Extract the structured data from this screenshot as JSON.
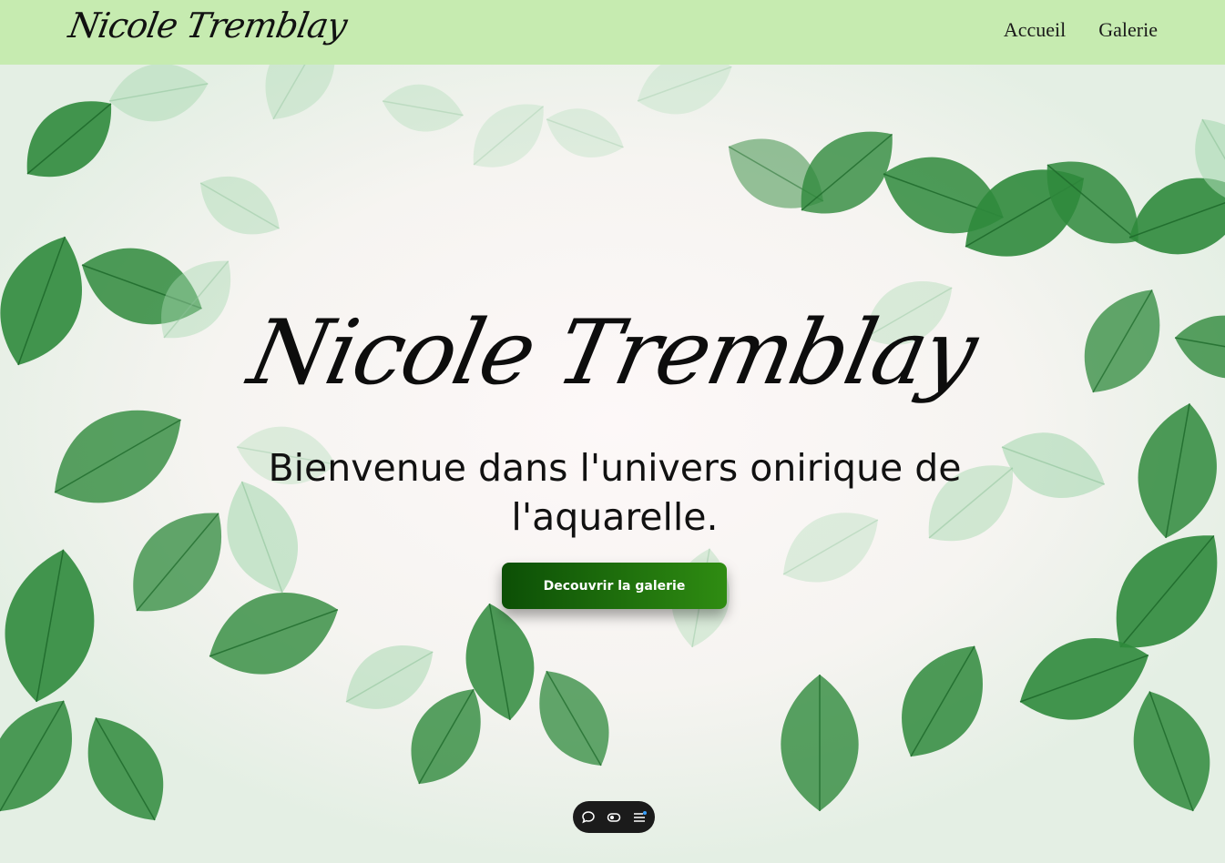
{
  "header": {
    "brand": "Nicole Tremblay",
    "nav": [
      {
        "label": "Accueil"
      },
      {
        "label": "Galerie"
      }
    ]
  },
  "hero": {
    "title": "Nicole Tremblay",
    "subtitle_line1": "Bienvenue dans l'univers onirique de",
    "subtitle_line2": "l'aquarelle.",
    "cta_label": "Decouvrir la galerie"
  },
  "toolbar": {
    "icons": [
      "chat-icon",
      "eye-icon",
      "menu-icon"
    ]
  },
  "colors": {
    "header_bg": "#c6ebb0",
    "button_start": "#0c4f06",
    "button_end": "#2f8c12",
    "leaf_dark": "#2f8a3c",
    "leaf_light": "#a9d9b2"
  }
}
